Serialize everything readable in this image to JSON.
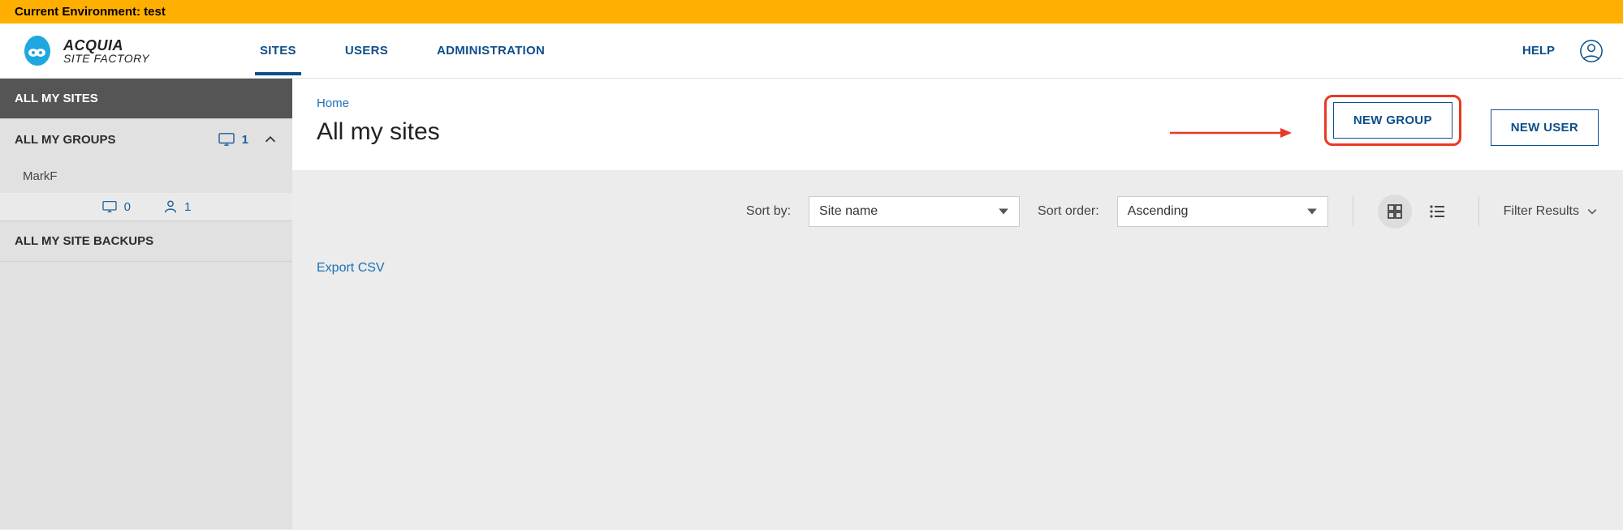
{
  "env_banner": "Current Environment: test",
  "logo": {
    "line1": "ACQUIA",
    "line2": "SITE FACTORY"
  },
  "nav": {
    "sites": "SITES",
    "users": "USERS",
    "administration": "ADMINISTRATION"
  },
  "help": "HELP",
  "sidebar": {
    "all_sites": "ALL MY SITES",
    "all_groups": "ALL MY GROUPS",
    "groups_count": "1",
    "group_name": "MarkF",
    "stat_sites": "0",
    "stat_users": "1",
    "all_backups": "ALL MY SITE BACKUPS"
  },
  "breadcrumb": "Home",
  "page_title": "All my sites",
  "buttons": {
    "new_group": "NEW GROUP",
    "new_user": "NEW USER"
  },
  "toolbar": {
    "sort_by_label": "Sort by:",
    "sort_by_value": "Site name",
    "sort_order_label": "Sort order:",
    "sort_order_value": "Ascending",
    "filter_label": "Filter Results"
  },
  "export_csv": "Export CSV"
}
